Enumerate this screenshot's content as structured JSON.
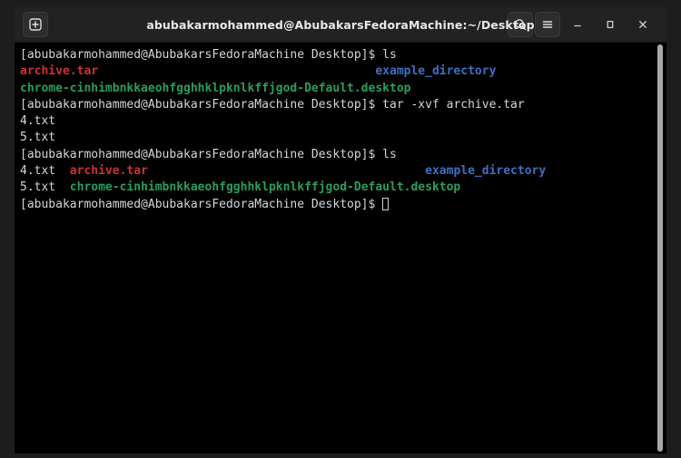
{
  "window": {
    "title": "abubakarmohammed@AbubakarsFedoraMachine:~/Desktop",
    "new_tab_label": "+",
    "search_label": "Search",
    "menu_label": "Menu",
    "minimize_label": "Minimize",
    "maximize_label": "Maximize",
    "close_label": "Close"
  },
  "colors": {
    "background": "#1d1d1d",
    "titlebar": "#222222",
    "terminal_bg": "#000000",
    "text": "#d6d6d6",
    "red": "#cc3232",
    "green": "#2a9d5c",
    "blue": "#3f6fc4",
    "scrollbar_thumb": "#a8a8a8"
  },
  "terminal": {
    "prompt": "[abubakarmohammed@AbubakarsFedoraMachine Desktop]$ ",
    "cursor": "block-outline",
    "lines": [
      {
        "type": "prompt",
        "segments": [
          {
            "text": "[abubakarmohammed@AbubakarsFedoraMachine Desktop]$ ",
            "color": "default"
          },
          {
            "text": "ls",
            "color": "default"
          }
        ]
      },
      {
        "type": "output",
        "segments": [
          {
            "text": "archive.tar",
            "color": "red"
          },
          {
            "text": "                                       ",
            "color": "default"
          },
          {
            "text": "example_directory",
            "color": "blue"
          }
        ]
      },
      {
        "type": "output",
        "segments": [
          {
            "text": "chrome-cinhimbnkkaeohfgghhklpknlkffjgod-Default.desktop",
            "color": "green"
          }
        ]
      },
      {
        "type": "prompt",
        "segments": [
          {
            "text": "[abubakarmohammed@AbubakarsFedoraMachine Desktop]$ ",
            "color": "default"
          },
          {
            "text": "tar -xvf archive.tar",
            "color": "default"
          }
        ]
      },
      {
        "type": "output",
        "segments": [
          {
            "text": "4.txt",
            "color": "default"
          }
        ]
      },
      {
        "type": "output",
        "segments": [
          {
            "text": "5.txt",
            "color": "default"
          }
        ]
      },
      {
        "type": "prompt",
        "segments": [
          {
            "text": "[abubakarmohammed@AbubakarsFedoraMachine Desktop]$ ",
            "color": "default"
          },
          {
            "text": "ls",
            "color": "default"
          }
        ]
      },
      {
        "type": "output",
        "segments": [
          {
            "text": "4.txt  ",
            "color": "default"
          },
          {
            "text": "archive.tar",
            "color": "red"
          },
          {
            "text": "                                       ",
            "color": "default"
          },
          {
            "text": "example_directory",
            "color": "blue"
          }
        ]
      },
      {
        "type": "output",
        "segments": [
          {
            "text": "5.txt  ",
            "color": "default"
          },
          {
            "text": "chrome-cinhimbnkkaeohfgghhklpknlkffjgod-Default.desktop",
            "color": "green"
          }
        ]
      },
      {
        "type": "prompt-cursor",
        "segments": [
          {
            "text": "[abubakarmohammed@AbubakarsFedoraMachine Desktop]$ ",
            "color": "default"
          }
        ]
      }
    ]
  }
}
